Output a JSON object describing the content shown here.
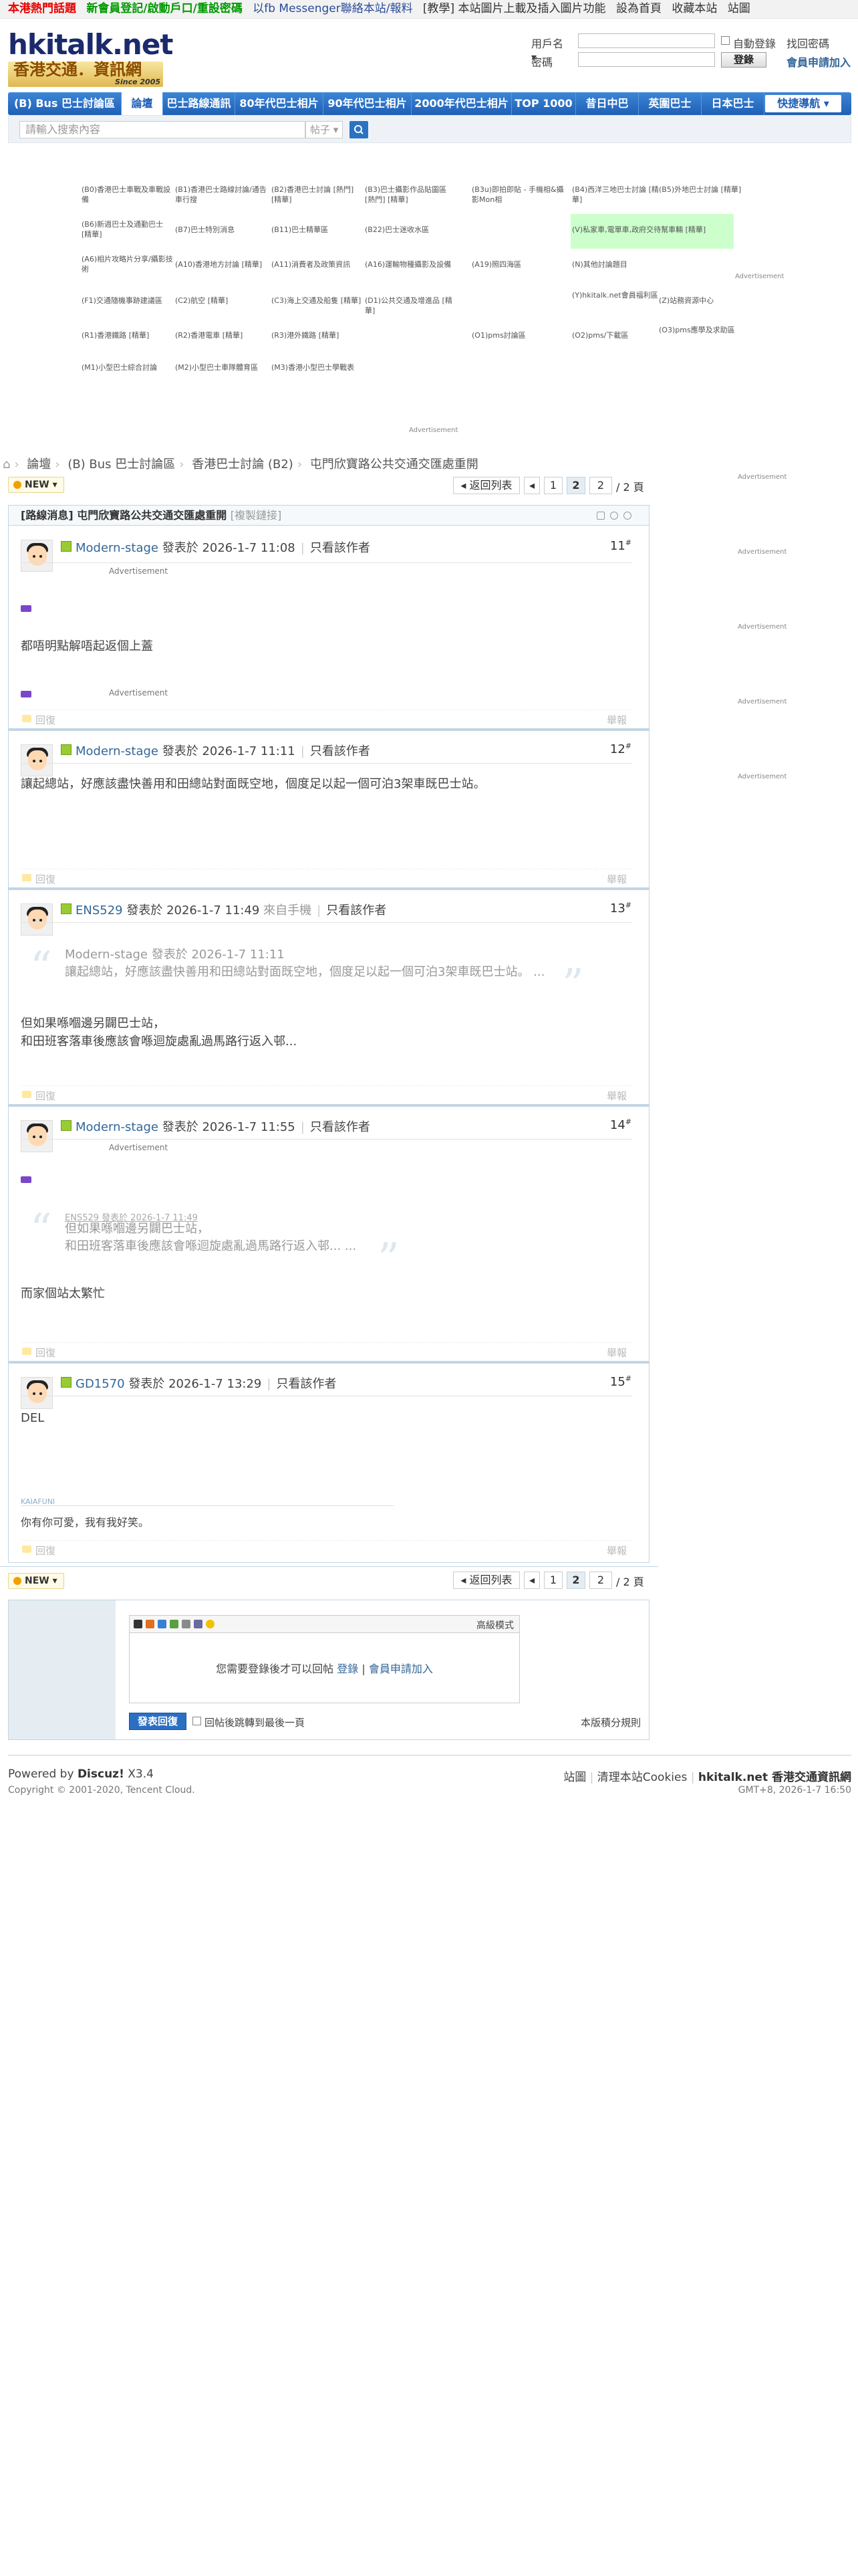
{
  "topbar": {
    "items": [
      "本港熱門話題",
      "新會員登記/啟動戶口/重設密碼",
      "以fb Messenger聯絡本站/報料",
      "[教學] 本站圖片上載及插入圖片功能",
      "設為首頁",
      "收藏本站",
      "站圖"
    ]
  },
  "logo": {
    "title": "hkitalk.net",
    "subtitle": "香港交通．資訊網",
    "since": "Since 2005"
  },
  "login": {
    "user_label": "用戶名 ▾",
    "pass_label": "密碼",
    "auto_login": "自動登錄",
    "forgot": "找回密碼",
    "login_btn": "登錄",
    "register": "會員申請加入"
  },
  "nav": {
    "items": [
      "(B) Bus 巴士討論區",
      "論壇",
      "巴士路線通訊",
      "80年代巴士相片",
      "90年代巴士相片",
      "2000年代巴士相片",
      "TOP 1000",
      "昔日中巴",
      "英圍巴士",
      "日本巴士"
    ],
    "quick": "快捷導航"
  },
  "search": {
    "placeholder": "請輸入搜索內容",
    "type": "帖子"
  },
  "forums": [
    "(B0)香港巴士車戰及車戰設備",
    "(B1)香港巴士路線討論/通告車行搜",
    "(B2)香港巴士討論 [熱門] [精華]",
    "(B3)巴士攝影作品貼圖區 [熱門] [精華]",
    "(B3u)即拍即貼 - 手機相&攝影Mon相",
    "(B4)西洋三地巴士討論 [精華]",
    "(B5)外地巴士討論 [精華]",
    "(B6)新週巴士及通勤巴士 [精華]",
    "(B7)巴士特別消息",
    "(B11)巴士精華區",
    "(B22)巴士迷收水區",
    "(V)私家車,電單車,政府交待幫車輛 [精華]",
    "(A6)相片攻略片分享/攝影技術",
    "(A10)香港地方討論 [精華]",
    "(A11)消費者及政策資訊",
    "(A16)運輸物種攝影及設備",
    "(A19)照四海區",
    "(N)其他討論題目",
    "(F1)交通隨機事跡建議區",
    "(C2)航空 [精華]",
    "(C3)海上交通及船隻 [精華]",
    "(D1)公共交通及增進品 [精華]",
    "(Y)hkitalk.net會員福利區",
    "(Z)站務資源中心",
    "(R1)香港鐵路 [精華]",
    "(R2)香港電車 [精華]",
    "(R3)港外鐵路 [精華]",
    "(O1)pms討論區",
    "(O2)pms/下載區",
    "(O3)pms應學及求助區",
    "(M1)小型巴士綜合討論",
    "(M2)小型巴士車隊體育區",
    "(M3)香港小型巴士學戰表"
  ],
  "advertisement": "Advertisement",
  "breadcrumb": [
    "論壇",
    "(B) Bus 巴士討論區",
    "香港巴士討論 (B2)",
    "屯門欣寶路公共交通交匯處重開"
  ],
  "toolbar": {
    "new": "NEW",
    "back": "返回列表",
    "pages": [
      "1",
      "2"
    ],
    "page_input": "2",
    "total": "/ 2 頁"
  },
  "thread": {
    "title": "[路線消息] 屯門欣寶路公共交通交匯處重開",
    "copy_link": "[複製鏈接]"
  },
  "posts": [
    {
      "author": "Modern-stage",
      "posted": "發表於 2026-1-7 11:08",
      "only_author": "只看該作者",
      "floor": "11",
      "body": [
        "都唔明點解唔起返個上蓋"
      ]
    },
    {
      "author": "Modern-stage",
      "posted": "發表於 2026-1-7 11:11",
      "only_author": "只看該作者",
      "floor": "12",
      "body": [
        "讓起總站，好應該盡快善用和田總站對面既空地，個度足以起一個可泊3架車既巴士站。"
      ]
    },
    {
      "author": "ENS529",
      "posted": "發表於 2026-1-7 11:49",
      "from": "來自手機",
      "only_author": "只看該作者",
      "floor": "13",
      "quote": [
        "Modern-stage 發表於 2026-1-7 11:11",
        "讓起總站，好應該盡快善用和田總站對面既空地，個度足以起一個可泊3架車既巴士站。 ..."
      ],
      "body": [
        "但如果喺嗰邊另闢巴士站，",
        "和田班客落車後應該會喺迴旋處亂過馬路行返入邨..."
      ]
    },
    {
      "author": "Modern-stage",
      "posted": "發表於 2026-1-7 11:55",
      "only_author": "只看該作者",
      "floor": "14",
      "quote": [
        "ENS529 發表於 2026-1-7 11:49",
        "但如果喺嗰邊另闢巴士站，",
        "和田班客落車後應該會喺迴旋處亂過馬路行返入邨... ..."
      ],
      "body": [
        "而家個站太繁忙"
      ]
    },
    {
      "author": "GD1570",
      "posted": "發表於 2026-1-7 13:29",
      "only_author": "只看該作者",
      "floor": "15",
      "body": [
        "DEL"
      ],
      "sig_name": "KAIAFUNI",
      "signature": "你有你可愛，我有我好笑。"
    }
  ],
  "post_actions": {
    "reply": "回復",
    "report": "舉報"
  },
  "reply_box": {
    "advanced": "高級模式",
    "notice_pre": "您需要登錄後才可以回帖",
    "login": "登錄",
    "register": "會員申請加入",
    "submit": "發表回復",
    "back_option": "回帖後跳轉到最後一頁",
    "rules": "本版積分規則"
  },
  "footer": {
    "powered": "Powered by",
    "brand": "Discuz!",
    "version": "X3.4",
    "copyright": "Copyright © 2001-2020, Tencent Cloud.",
    "links": [
      "站圖",
      "清理本站Cookies",
      "hkitalk.net 香港交通資訊網"
    ],
    "time": "GMT+8, 2026-1-7 16:50"
  },
  "colors": {
    "nav_blue": "#1f5fb6",
    "link": "#336699",
    "border": "#c2d5e3",
    "highlight": "#ccffcc"
  }
}
